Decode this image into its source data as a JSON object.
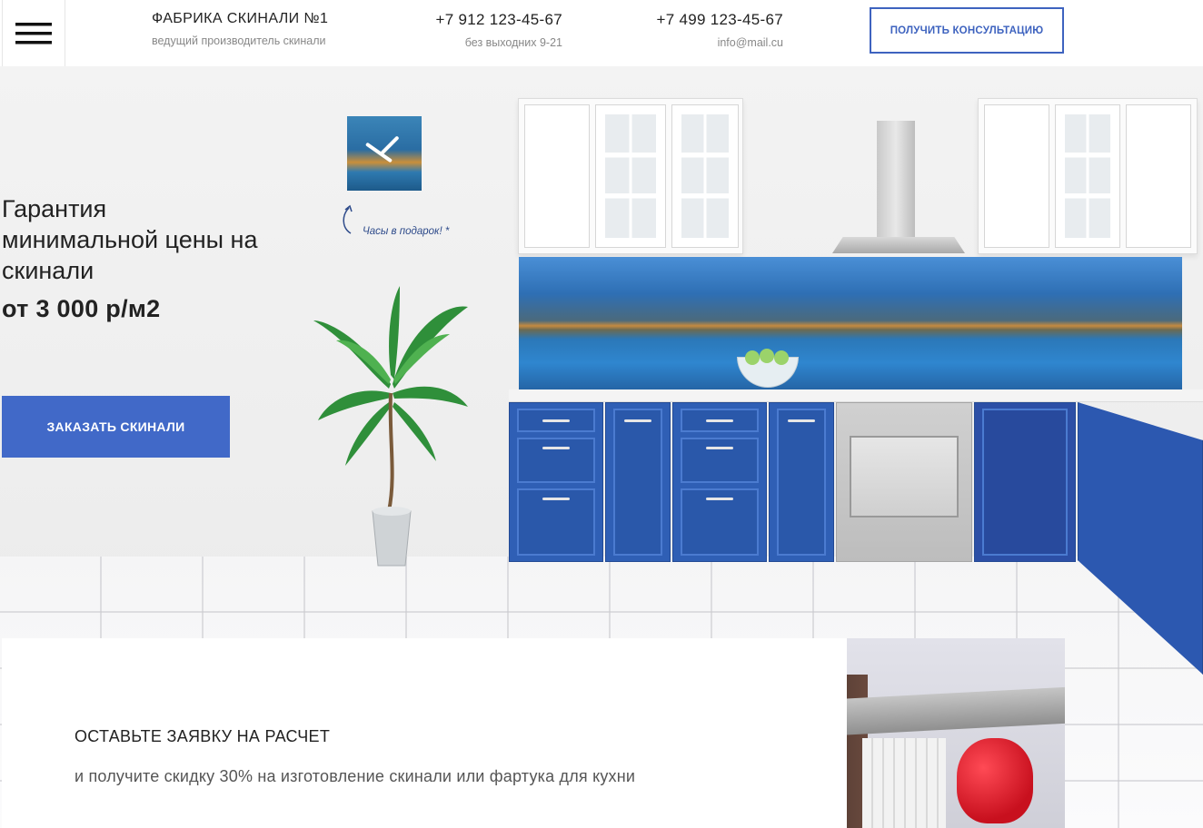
{
  "header": {
    "menu_icon": "hamburger-menu-icon",
    "brand_title": "ФАБРИКА СКИНАЛИ №1",
    "brand_subtitle": "ведущий производитель скинали",
    "phone1": "+7 912 123-45-67",
    "phone1_note": "без выходних 9-21",
    "phone2": "+7 499 123-45-67",
    "email": "info@mail.cu",
    "consult_button": "ПОЛУЧИТЬ КОНСУЛЬТАЦИЮ"
  },
  "hero": {
    "title": "Гарантия минимальной цены на скинали",
    "price": "от 3 000 р/м2",
    "order_button": "ЗАКАЗАТЬ СКИНАЛИ",
    "gift_note": "Часы в подарок! *"
  },
  "lead": {
    "title": "ОСТАВЬТЕ ЗАЯВКУ НА РАСЧЕТ",
    "subtitle": "и получите скидку 30% на изготовление скинали или фартука для кухни"
  },
  "colors": {
    "accent": "#4169c8",
    "accent_border": "#3e63bf",
    "text": "#222222",
    "muted": "#888888"
  }
}
